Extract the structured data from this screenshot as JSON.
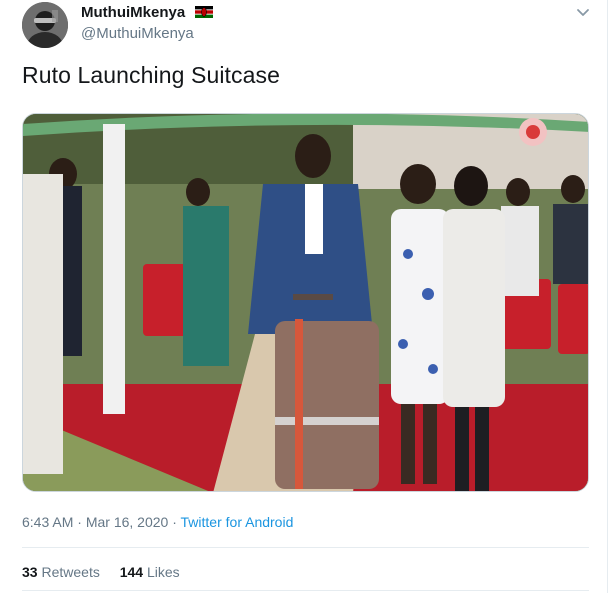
{
  "tweet": {
    "author": {
      "display_name": "MuthuiMkenya",
      "handle": "@MuthuiMkenya",
      "avatar": "grayscale profile photo",
      "flag_icon": "kenya-flag-icon"
    },
    "text": "Ruto Launching Suitcase",
    "meta": {
      "time": "6:43 AM",
      "sep1": " · ",
      "date": "Mar 16, 2020",
      "sep2": " · ",
      "source": "Twitter for Android"
    },
    "stats": {
      "retweets_count": "33",
      "retweets_label": "Retweets",
      "likes_count": "144",
      "likes_label": "Likes"
    },
    "colors": {
      "link": "#1b95e0",
      "muted": "#657786",
      "text": "#14171a",
      "border": "#e6ecf0"
    }
  }
}
